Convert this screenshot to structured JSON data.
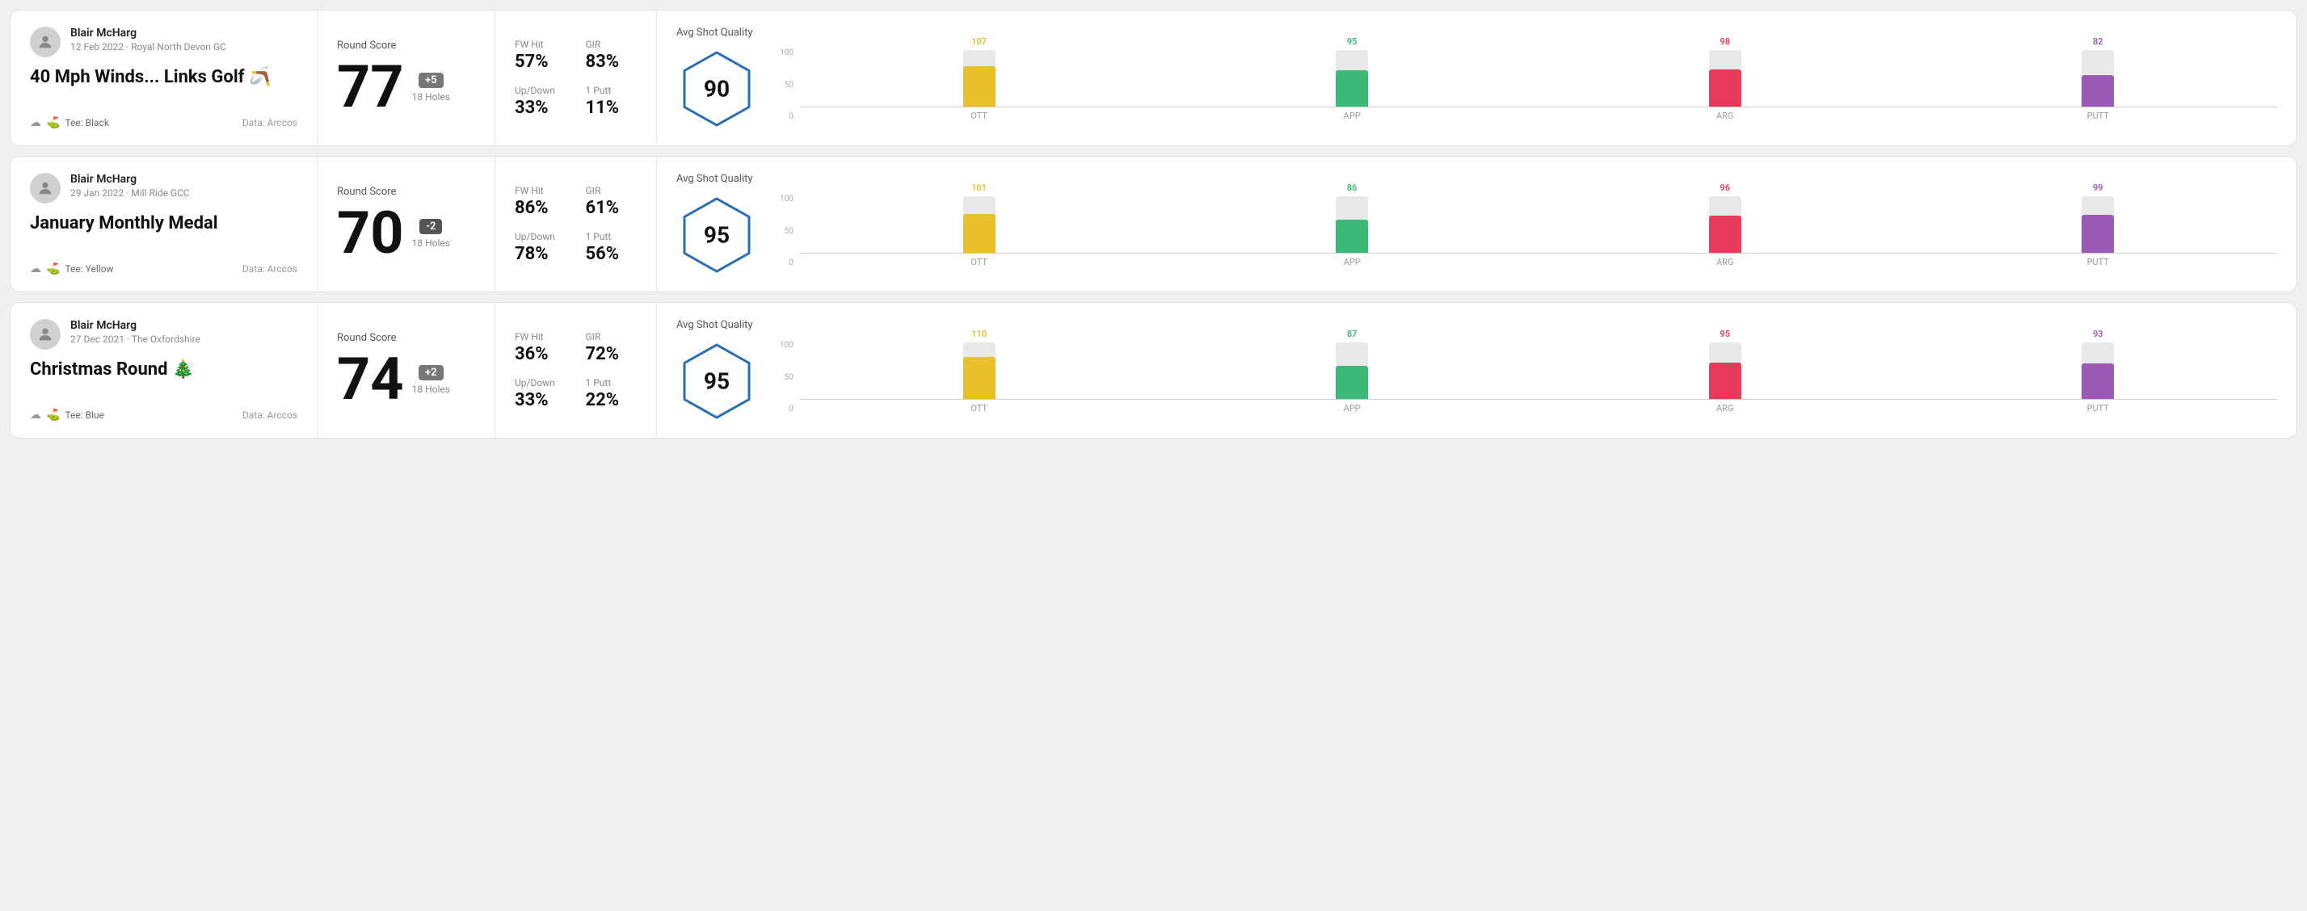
{
  "rounds": [
    {
      "id": "round-1",
      "user": {
        "name": "Blair McHarg",
        "date": "12 Feb 2022",
        "course": "Royal North Devon GC"
      },
      "title": "40 Mph Winds... Links Golf 🪃",
      "tee": "Black",
      "data_source": "Data: Arccos",
      "score": {
        "label": "Round Score",
        "value": "77",
        "modifier": "+5",
        "modifier_type": "positive",
        "holes": "18 Holes"
      },
      "stats": {
        "fw_hit_label": "FW Hit",
        "fw_hit_value": "57%",
        "gir_label": "GIR",
        "gir_value": "83%",
        "updown_label": "Up/Down",
        "updown_value": "33%",
        "oneputt_label": "1 Putt",
        "oneputt_value": "11%"
      },
      "shot_quality": {
        "label": "Avg Shot Quality",
        "score": "90",
        "bars": [
          {
            "label": "OTT",
            "value": 107,
            "color": "#e8c02a",
            "height_pct": 72
          },
          {
            "label": "APP",
            "value": 95,
            "color": "#3cb879",
            "height_pct": 64
          },
          {
            "label": "ARG",
            "value": 98,
            "color": "#e83a5a",
            "height_pct": 66
          },
          {
            "label": "PUTT",
            "value": 82,
            "color": "#9b59b6",
            "height_pct": 55
          }
        ]
      }
    },
    {
      "id": "round-2",
      "user": {
        "name": "Blair McHarg",
        "date": "29 Jan 2022",
        "course": "Mill Ride GCC"
      },
      "title": "January Monthly Medal",
      "tee": "Yellow",
      "data_source": "Data: Arccos",
      "score": {
        "label": "Round Score",
        "value": "70",
        "modifier": "-2",
        "modifier_type": "negative",
        "holes": "18 Holes"
      },
      "stats": {
        "fw_hit_label": "FW Hit",
        "fw_hit_value": "86%",
        "gir_label": "GIR",
        "gir_value": "61%",
        "updown_label": "Up/Down",
        "updown_value": "78%",
        "oneputt_label": "1 Putt",
        "oneputt_value": "56%"
      },
      "shot_quality": {
        "label": "Avg Shot Quality",
        "score": "95",
        "bars": [
          {
            "label": "OTT",
            "value": 101,
            "color": "#e8c02a",
            "height_pct": 68
          },
          {
            "label": "APP",
            "value": 86,
            "color": "#3cb879",
            "height_pct": 58
          },
          {
            "label": "ARG",
            "value": 96,
            "color": "#e83a5a",
            "height_pct": 65
          },
          {
            "label": "PUTT",
            "value": 99,
            "color": "#9b59b6",
            "height_pct": 67
          }
        ]
      }
    },
    {
      "id": "round-3",
      "user": {
        "name": "Blair McHarg",
        "date": "27 Dec 2021",
        "course": "The Oxfordshire"
      },
      "title": "Christmas Round 🎄",
      "tee": "Blue",
      "data_source": "Data: Arccos",
      "score": {
        "label": "Round Score",
        "value": "74",
        "modifier": "+2",
        "modifier_type": "positive",
        "holes": "18 Holes"
      },
      "stats": {
        "fw_hit_label": "FW Hit",
        "fw_hit_value": "36%",
        "gir_label": "GIR",
        "gir_value": "72%",
        "updown_label": "Up/Down",
        "updown_value": "33%",
        "oneputt_label": "1 Putt",
        "oneputt_value": "22%"
      },
      "shot_quality": {
        "label": "Avg Shot Quality",
        "score": "95",
        "bars": [
          {
            "label": "OTT",
            "value": 110,
            "color": "#e8c02a",
            "height_pct": 74
          },
          {
            "label": "APP",
            "value": 87,
            "color": "#3cb879",
            "height_pct": 59
          },
          {
            "label": "ARG",
            "value": 95,
            "color": "#e83a5a",
            "height_pct": 64
          },
          {
            "label": "PUTT",
            "value": 93,
            "color": "#9b59b6",
            "height_pct": 63
          }
        ]
      }
    }
  ],
  "labels": {
    "data_label": "Data: Arccos",
    "y_axis_100": "100",
    "y_axis_50": "50",
    "y_axis_0": "0"
  }
}
